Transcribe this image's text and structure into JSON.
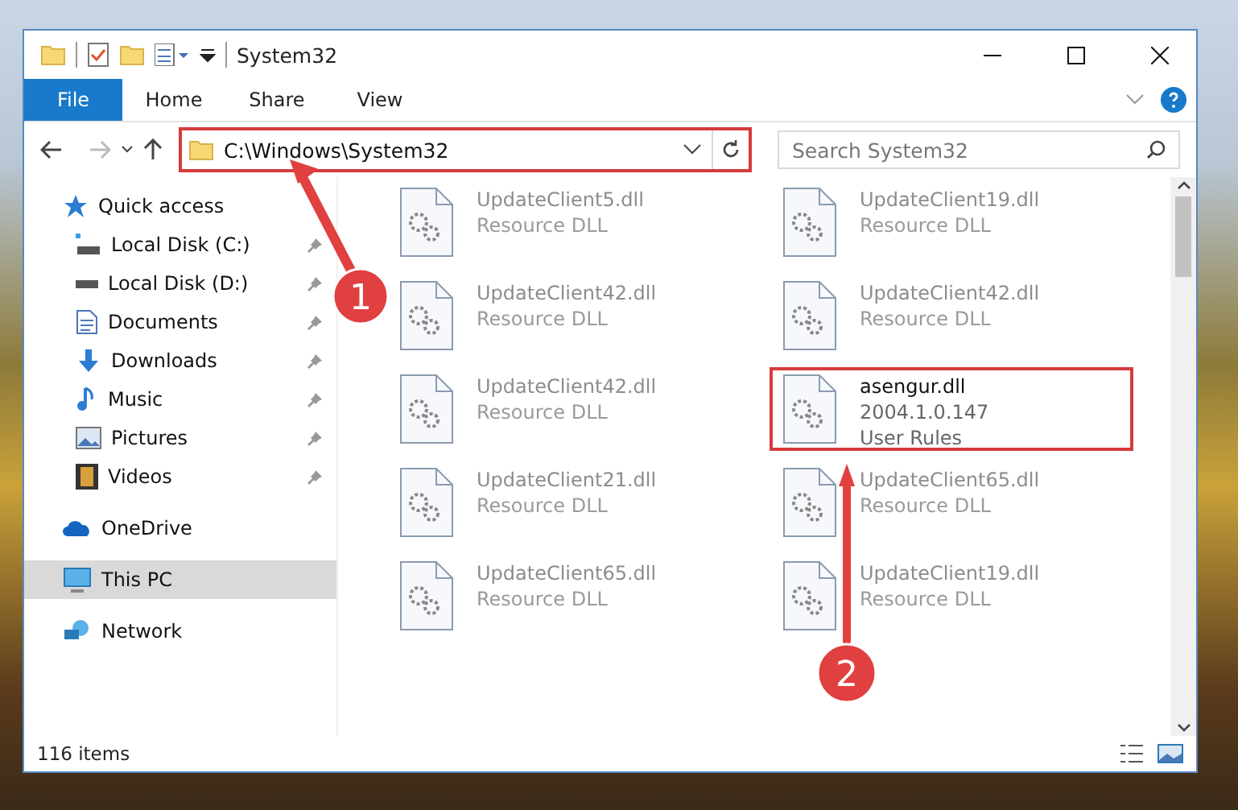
{
  "window": {
    "title": "System32"
  },
  "ribbon": {
    "tabs": [
      {
        "label": "File",
        "selected": true
      },
      {
        "label": "Home",
        "selected": false
      },
      {
        "label": "Share",
        "selected": false
      },
      {
        "label": "View",
        "selected": false
      }
    ]
  },
  "address": {
    "path": "C:\\Windows\\System32",
    "marked": true
  },
  "search": {
    "placeholder": "Search System32"
  },
  "sidebar": {
    "items": [
      {
        "label": "Quick access",
        "selected": false,
        "children": [
          {
            "label": "Local Disk (C:)",
            "pinned": true,
            "selected": false
          },
          {
            "label": "Local Disk (D:)",
            "pinned": true,
            "selected": false
          },
          {
            "label": "Documents",
            "pinned": true,
            "selected": false
          },
          {
            "label": "Downloads",
            "pinned": true,
            "selected": false
          },
          {
            "label": "Music",
            "pinned": true,
            "selected": false
          },
          {
            "label": "Pictures",
            "pinned": true,
            "selected": false
          },
          {
            "label": "Videos",
            "pinned": true,
            "selected": false
          }
        ]
      },
      {
        "label": "OneDrive",
        "selected": false
      },
      {
        "label": "This PC",
        "selected": true
      },
      {
        "label": "Network",
        "selected": false
      }
    ]
  },
  "files": [
    {
      "name": "UpdateClient5.dll",
      "details": [
        "Resource DLL"
      ],
      "dimmed": true,
      "marked": false
    },
    {
      "name": "UpdateClient19.dll",
      "details": [
        "Resource DLL"
      ],
      "dimmed": true,
      "marked": false
    },
    {
      "name": "UpdateClient42.dll",
      "details": [
        "Resource DLL"
      ],
      "dimmed": true,
      "marked": false
    },
    {
      "name": "UpdateClient42.dll",
      "details": [
        "Resource DLL"
      ],
      "dimmed": true,
      "marked": false
    },
    {
      "name": "UpdateClient42.dll",
      "details": [
        "Resource DLL"
      ],
      "dimmed": true,
      "marked": false
    },
    {
      "name": "asengur.dll",
      "details": [
        "2004.1.0.147",
        "User Rules"
      ],
      "dimmed": false,
      "marked": true
    },
    {
      "name": "UpdateClient21.dll",
      "details": [
        "Resource DLL"
      ],
      "dimmed": true,
      "marked": false
    },
    {
      "name": "UpdateClient65.dll",
      "details": [
        "Resource DLL"
      ],
      "dimmed": true,
      "marked": false
    },
    {
      "name": "UpdateClient65.dll",
      "details": [
        "Resource DLL"
      ],
      "dimmed": true,
      "marked": false
    },
    {
      "name": "UpdateClient19.dll",
      "details": [
        "Resource DLL"
      ],
      "dimmed": true,
      "marked": false
    }
  ],
  "status_bar": {
    "count": "116 items"
  },
  "callouts": [
    {
      "label": "1"
    },
    {
      "label": "2"
    }
  ]
}
